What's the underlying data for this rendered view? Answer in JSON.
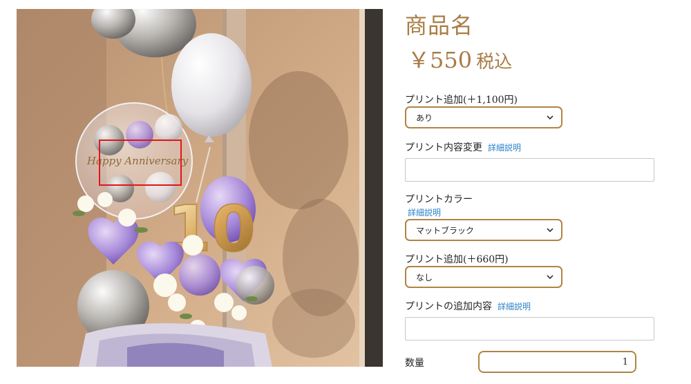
{
  "product": {
    "title": "商品名",
    "price": "￥550",
    "tax_label": "税込",
    "image_text": "Happy Anniversary",
    "balloon_number": "10"
  },
  "options": {
    "print_add": {
      "label": "プリント追加(＋1,100円)",
      "selected": "あり"
    },
    "print_change": {
      "label": "プリント内容変更",
      "help": "詳細説明",
      "value": ""
    },
    "print_color": {
      "label": "プリントカラー",
      "help": "詳細説明",
      "selected": "マットブラック"
    },
    "print_add2": {
      "label": "プリント追加(＋660円)",
      "selected": "なし"
    },
    "print_extra": {
      "label": "プリントの追加内容",
      "help": "詳細説明",
      "value": ""
    },
    "quantity": {
      "label": "数量",
      "value": "1"
    }
  },
  "colors": {
    "accent": "#a97c45",
    "select_border": "#b08343",
    "link": "#2b82c9",
    "highlight": "#e0161b"
  },
  "icons": {
    "select_arrow": "chevron-down-icon"
  }
}
